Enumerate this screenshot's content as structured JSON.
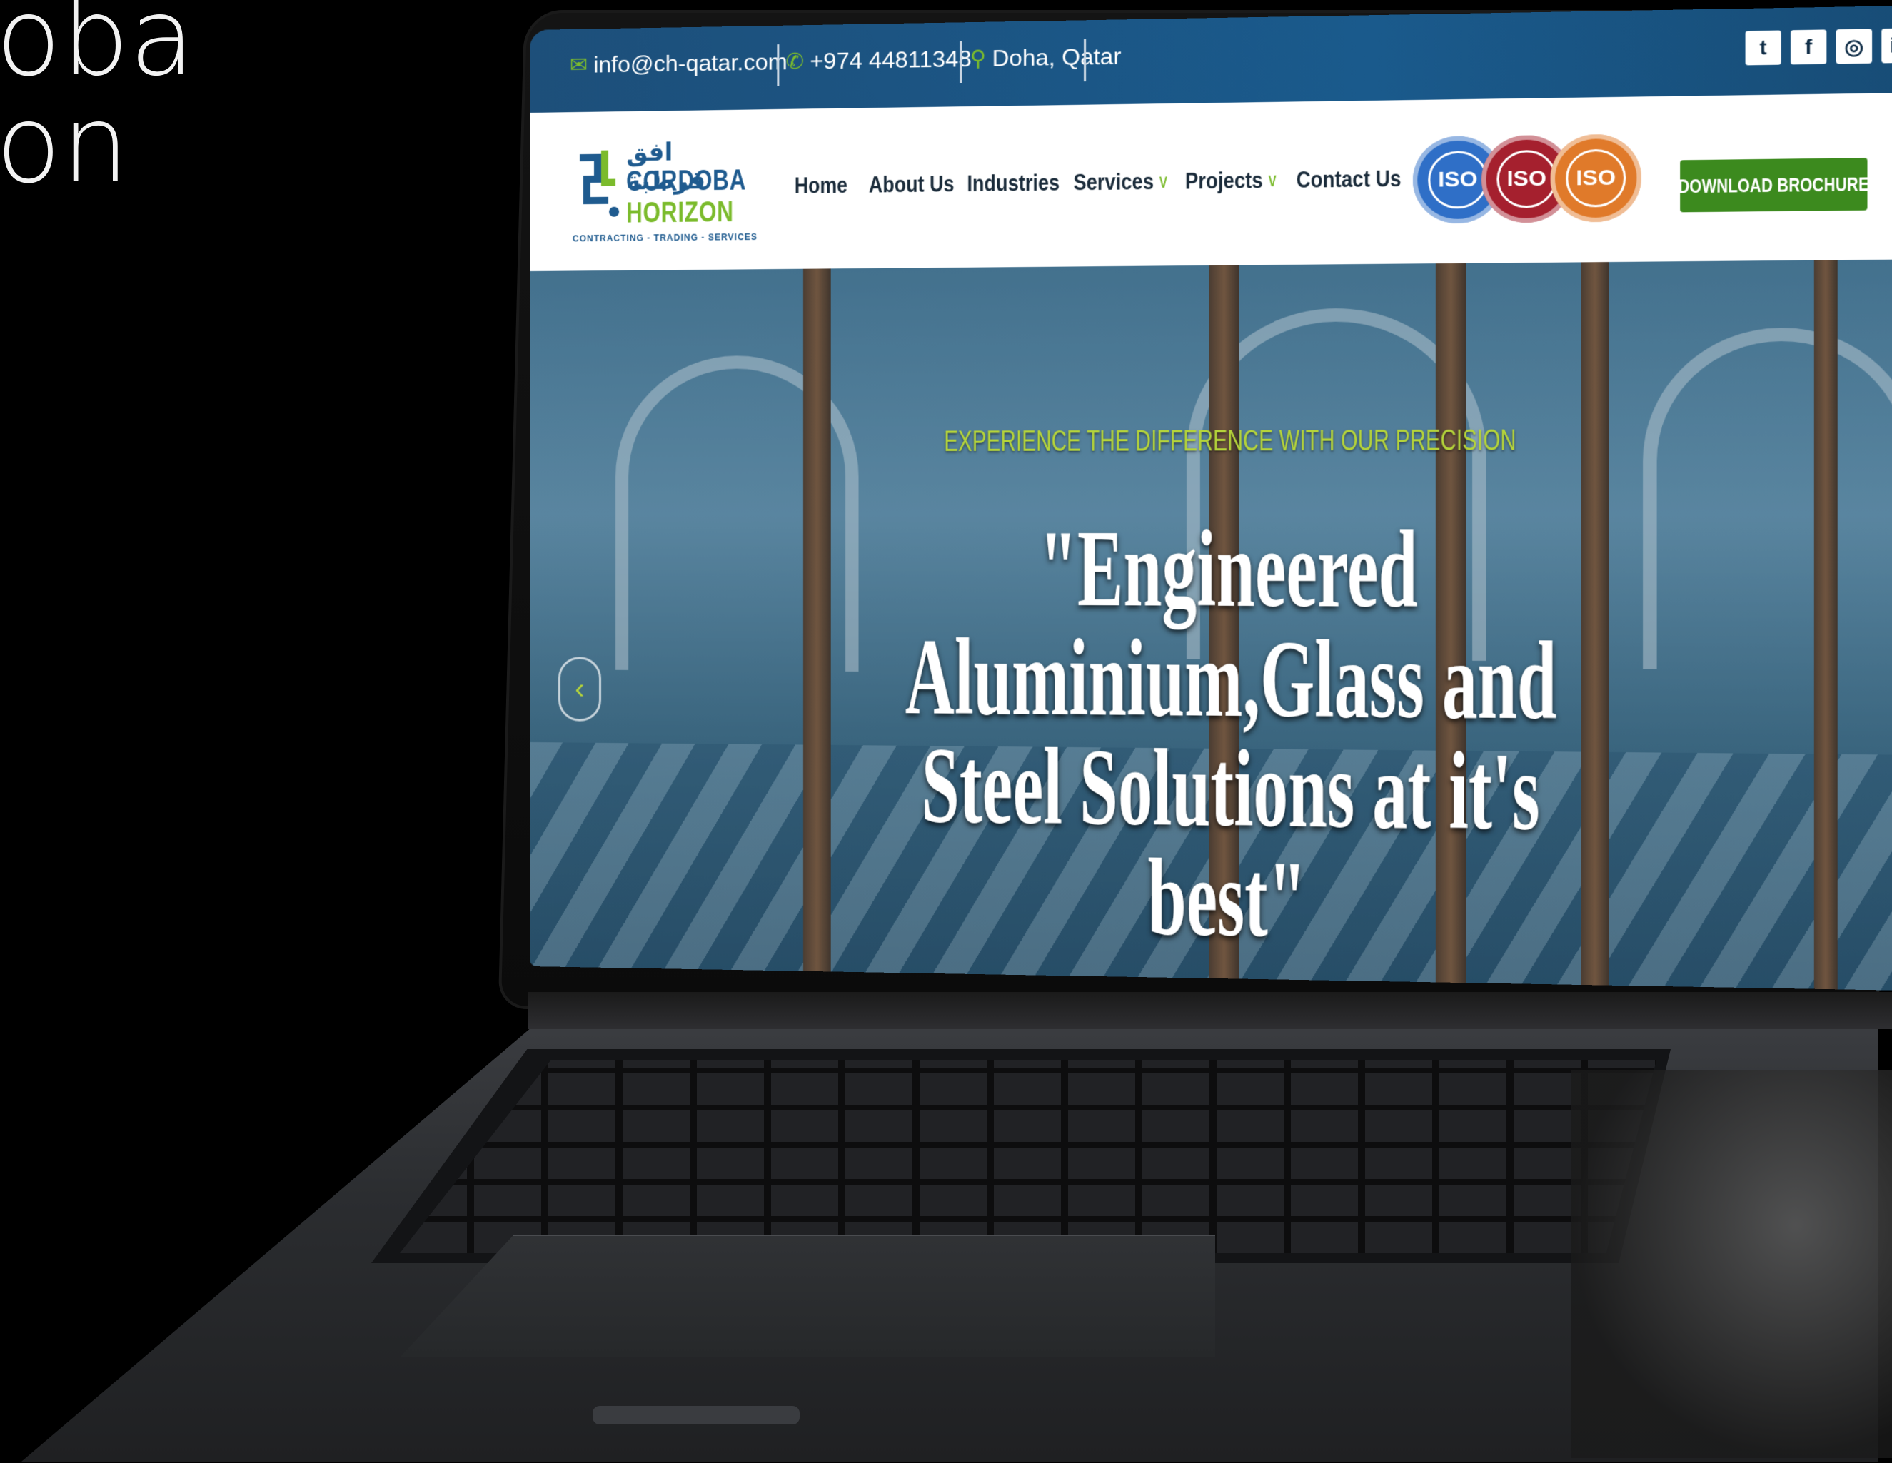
{
  "slide": {
    "line1": "oba",
    "line2": "on"
  },
  "topbar": {
    "email": "info@ch-qatar.com",
    "phone": "+974 44811348",
    "location": "Doha, Qatar",
    "social": [
      "twitter-icon",
      "facebook-icon",
      "instagram-icon",
      "linkedin-icon"
    ]
  },
  "logo": {
    "arabic": "افق قرطبة",
    "line1": "CORDOBA",
    "line2": "HORIZON",
    "tagline": "CONTRACTING - TRADING - SERVICES"
  },
  "nav": {
    "home": "Home",
    "about": "About Us",
    "industries": "Industries",
    "services": "Services",
    "projects": "Projects",
    "contact": "Contact Us"
  },
  "iso": [
    "ISO",
    "ISO",
    "ISO"
  ],
  "brochure_label": "DOWNLOAD BROCHURE",
  "hero": {
    "tagline": "EXPERIENCE THE DIFFERENCE WITH OUR PRECISION",
    "line1": "\"Engineered",
    "line2": "Aluminium,Glass and",
    "line3": "Steel Solutions at it's",
    "line4": "best\""
  },
  "colors": {
    "topbar": "#1a5a8c",
    "accent_green": "#7bbb2c",
    "button_green": "#3c8a1e",
    "tagline_green": "#b5d43a",
    "iso_colors": [
      "#2f6fc7",
      "#a5202e",
      "#e07a2a"
    ]
  }
}
